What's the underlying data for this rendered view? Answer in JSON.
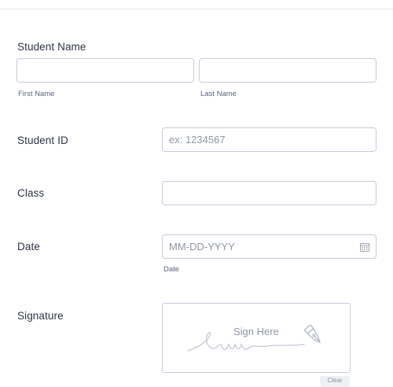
{
  "student_name": {
    "label": "Student Name",
    "first_name": {
      "value": "",
      "sublabel": "First Name"
    },
    "last_name": {
      "value": "",
      "sublabel": "Last Name"
    }
  },
  "student_id": {
    "label": "Student ID",
    "placeholder": "ex: 1234567"
  },
  "class_field": {
    "label": "Class",
    "value": ""
  },
  "date": {
    "label": "Date",
    "placeholder": "MM-DD-YYYY",
    "sublabel": "Date",
    "icon": "calendar-icon"
  },
  "signature": {
    "label": "Signature",
    "prompt": "Sign Here",
    "icon": "pen-nib-icon",
    "clear_label": "Clear"
  },
  "colors": {
    "text": "#2c3345",
    "border": "#c3cad8",
    "placeholder": "#8f96a3"
  }
}
